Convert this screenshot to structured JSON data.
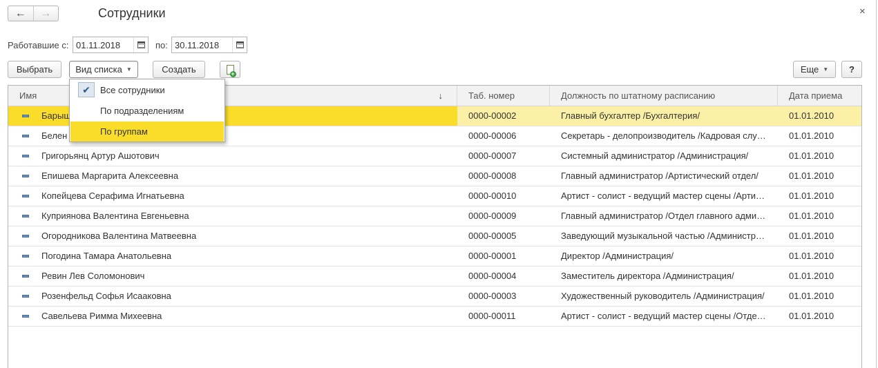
{
  "window": {
    "title": "Сотрудники",
    "back_icon": "arrow-left-icon",
    "forward_icon": "arrow-right-icon",
    "close_icon": "close-icon",
    "back_glyph": "←",
    "forward_glyph": "→",
    "close_glyph": "×"
  },
  "filter": {
    "from_label": "Работавшие с:",
    "from_value": "01.11.2018",
    "to_label": "по:",
    "to_value": "30.11.2018",
    "calendar_icon": "calendar-icon"
  },
  "toolbar": {
    "select_label": "Выбрать",
    "view_label": "Вид списка",
    "create_label": "Создать",
    "copy_icon": "create-copy-icon",
    "more_label": "Еще",
    "help_label": "?"
  },
  "view_menu": {
    "items": [
      {
        "label": "Все сотрудники",
        "checked": true
      },
      {
        "label": "По подразделениям",
        "checked": false
      },
      {
        "label": "По группам",
        "checked": false,
        "highlighted": true
      }
    ],
    "check_glyph": "✔"
  },
  "table": {
    "columns": [
      "Имя",
      "Таб. номер",
      "Должность по штатному расписанию",
      "Дата приема"
    ],
    "sort_indicator": "↓",
    "row_icon": "employee-item-icon",
    "rows": [
      {
        "name": "Барыш",
        "tab": "0000-00002",
        "position": "Главный бухгалтер /Бухгалтерия/",
        "date": "01.01.2010",
        "selected": true
      },
      {
        "name": "Белен",
        "tab": "0000-00006",
        "position": "Секретарь - делопроизводитель /Кадровая слу…",
        "date": "01.01.2010"
      },
      {
        "name": "Григорьянц Артур Ашотович",
        "tab": "0000-00007",
        "position": "Системный администратор /Администрация/",
        "date": "01.01.2010"
      },
      {
        "name": "Епишева Маргарита Алексеевна",
        "tab": "0000-00008",
        "position": "Главный администратор /Артистический отдел/",
        "date": "01.01.2010"
      },
      {
        "name": "Копейцева Серафима Игнатьевна",
        "tab": "0000-00010",
        "position": "Артист - солист - ведущий мастер сцены /Арти…",
        "date": "01.01.2010"
      },
      {
        "name": "Куприянова Валентина Евгеньевна",
        "tab": "0000-00009",
        "position": "Главный администратор /Отдел главного адми…",
        "date": "01.01.2010"
      },
      {
        "name": "Огородникова Валентина Матвеевна",
        "tab": "0000-00005",
        "position": "Заведующий музыкальной частью /Администр…",
        "date": "01.01.2010"
      },
      {
        "name": "Погодина Тамара Анатольевна",
        "tab": "0000-00001",
        "position": "Директор /Администрация/",
        "date": "01.01.2010"
      },
      {
        "name": "Ревин Лев Соломонович",
        "tab": "0000-00004",
        "position": "Заместитель директора /Администрация/",
        "date": "01.01.2010"
      },
      {
        "name": "Розенфельд Софья Исааковна",
        "tab": "0000-00003",
        "position": "Художественный руководитель /Администрация/",
        "date": "01.01.2010"
      },
      {
        "name": "Савельева Римма Михеевна",
        "tab": "0000-00011",
        "position": "Артист - солист - ведущий мастер сцены /Отде…",
        "date": "01.01.2010"
      }
    ]
  },
  "colors": {
    "selection": "#fadc2a",
    "selection_row": "#fbf0a6",
    "header_bg": "#f2f2f2",
    "border": "#b5b5b5"
  }
}
